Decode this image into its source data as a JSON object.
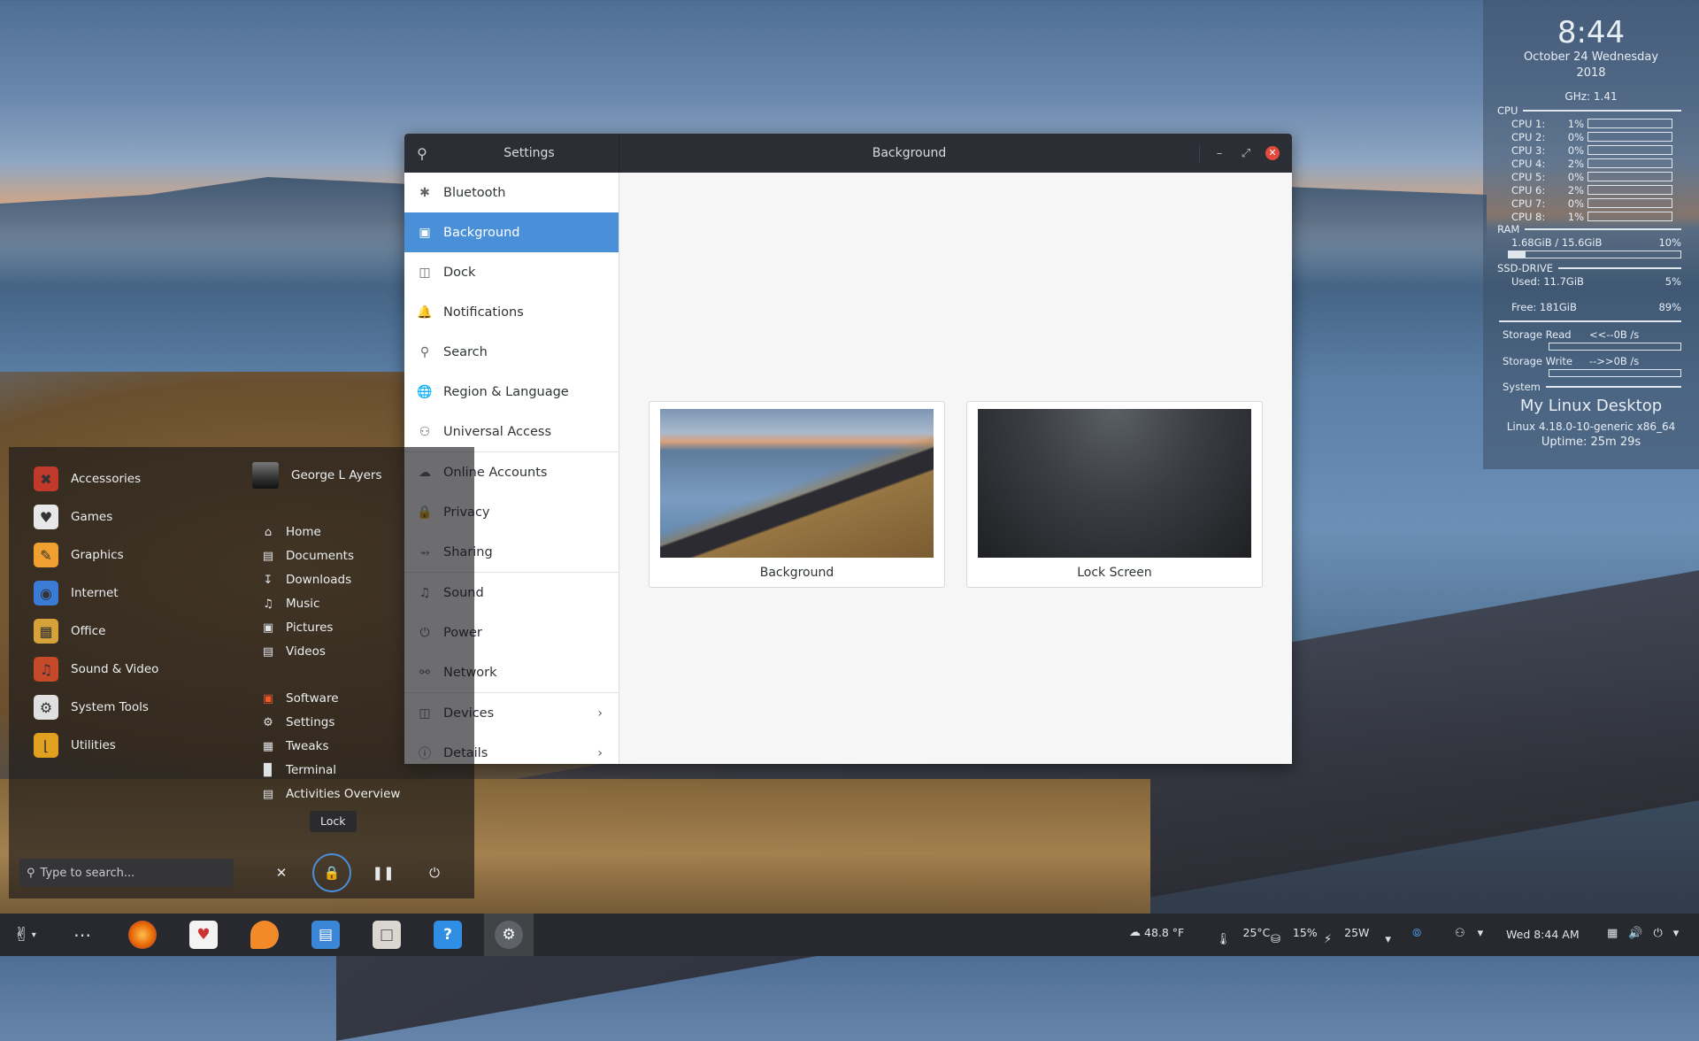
{
  "conky": {
    "time": "8:44",
    "date_line": "October 24 Wednesday",
    "year": "2018",
    "ghz": "GHz: 1.41",
    "cpu_label": "CPU",
    "cpus": [
      {
        "label": "CPU 1:",
        "pct": "1%"
      },
      {
        "label": "CPU 2:",
        "pct": "0%"
      },
      {
        "label": "CPU 3:",
        "pct": "0%"
      },
      {
        "label": "CPU 4:",
        "pct": "2%"
      },
      {
        "label": "CPU 5:",
        "pct": "0%"
      },
      {
        "label": "CPU 6:",
        "pct": "2%"
      },
      {
        "label": "CPU 7:",
        "pct": "0%"
      },
      {
        "label": "CPU 8:",
        "pct": "1%"
      }
    ],
    "ram_label": "RAM",
    "ram_value": "1.68GiB / 15.6GiB",
    "ram_pct": "10%",
    "ram_fraction": 0.1,
    "ssd_label": "SSD-DRIVE",
    "ssd_used": "Used:  11.7GiB",
    "ssd_used_pct": "5%",
    "ssd_free": "Free:  181GiB",
    "ssd_free_pct": "89%",
    "storage_read": "Storage Read",
    "storage_read_val": "<<--0B  /s",
    "storage_write": "Storage Write",
    "storage_write_val": "-->>0B  /s",
    "system_label": "System",
    "desktop_name": "My Linux Desktop",
    "kernel": "Linux 4.18.0-10-generic x86_64",
    "uptime": "Uptime: 25m 29s"
  },
  "settings": {
    "sidebar_title": "Settings",
    "page_title": "Background",
    "items": [
      {
        "label": "Bluetooth",
        "icon": "bluetooth-icon"
      },
      {
        "label": "Background",
        "icon": "background-icon",
        "active": true
      },
      {
        "label": "Dock",
        "icon": "dock-icon"
      },
      {
        "label": "Notifications",
        "icon": "bell-icon"
      },
      {
        "label": "Search",
        "icon": "search-icon"
      },
      {
        "label": "Region & Language",
        "icon": "globe-icon"
      },
      {
        "label": "Universal Access",
        "icon": "accessibility-icon"
      },
      {
        "label": "Online Accounts",
        "icon": "cloud-icon"
      },
      {
        "label": "Privacy",
        "icon": "lock-icon"
      },
      {
        "label": "Sharing",
        "icon": "share-icon"
      },
      {
        "label": "Sound",
        "icon": "music-note-icon"
      },
      {
        "label": "Power",
        "icon": "power-icon"
      },
      {
        "label": "Network",
        "icon": "network-icon"
      },
      {
        "label": "Devices",
        "icon": "devices-icon"
      },
      {
        "label": "Details",
        "icon": "info-icon"
      }
    ],
    "cards": [
      {
        "caption": "Background"
      },
      {
        "caption": "Lock Screen"
      }
    ]
  },
  "menu": {
    "categories": [
      "Accessories",
      "Games",
      "Graphics",
      "Internet",
      "Office",
      "Sound & Video",
      "System Tools",
      "Utilities"
    ],
    "user": "George L Ayers",
    "places": [
      "Home",
      "Documents",
      "Downloads",
      "Music",
      "Pictures",
      "Videos"
    ],
    "apps": [
      "Software",
      "Settings",
      "Tweaks",
      "Terminal",
      "Activities Overview"
    ],
    "search_placeholder": "Type to search...",
    "lock_tooltip": "Lock"
  },
  "panel": {
    "weather": "48.8 °F",
    "temp": "25°C",
    "disk": "15%",
    "power": "25W",
    "clock": "Wed  8:44 AM"
  }
}
